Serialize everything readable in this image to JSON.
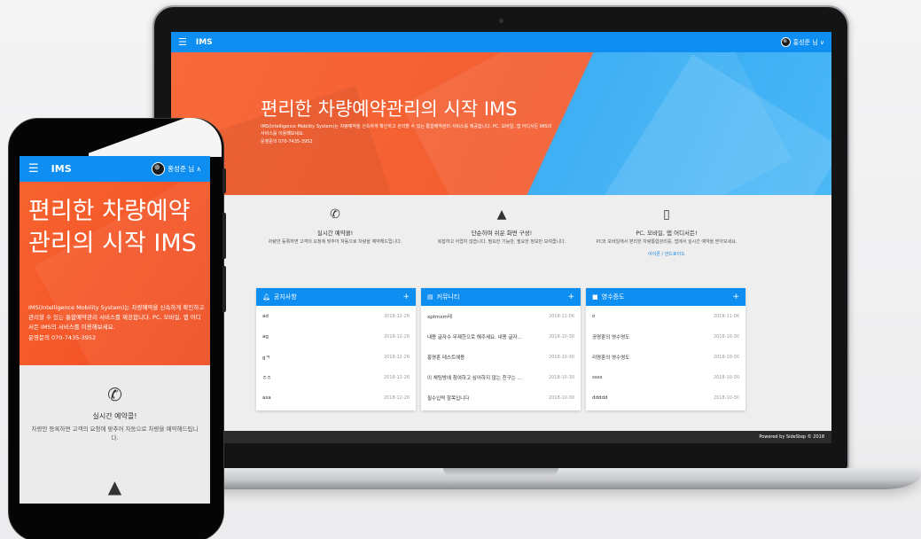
{
  "laptop": {
    "appbar": {
      "menu_icon": "menu-icon",
      "title": "IMS",
      "user": "홍성준 님 ∨"
    },
    "hero": {
      "title": "편리한 차량예약관리의 시작 IMS",
      "desc": "IMS(Intelligence Mobility System)는 차량예약을 신속하게 확인하고 관리할 수 있는 통합예약관리 서비스를 제공합니다. PC, 모바일, 앱 어디서든 IMS의 서비스를 이용해보세요.",
      "phone": "운영문의 070-7435-3952"
    },
    "features": [
      {
        "icon": "phone-call-icon",
        "title": "실시간 예약콜!",
        "desc": "차량만 등록하면 고객의 요청에 맞추어 자동으로 차량을 예약해드립니다.",
        "link": ""
      },
      {
        "icon": "shapes-icon",
        "title": "단순하며 쉬운 화면 구성!",
        "desc": "복잡하고 어렵지 않습니다. 필요한 기능만, 필요한 정보만 보여줍니다.",
        "link": ""
      },
      {
        "icon": "mobile-device-icon",
        "title": "PC, 모바일, 앱 어디서든!",
        "desc": "PC와 모바일에서 편리한 차량통합관리를, 앱에서 실시간 예약을 받아보세요.",
        "link": "아이폰 / 안드로이드"
      }
    ],
    "cards": [
      {
        "icon": "bell-icon",
        "title": "공지사항",
        "plus": "+",
        "rows": [
          {
            "text": "ad",
            "date": "2018-12-26"
          },
          {
            "text": "ag",
            "date": "2018-12-26"
          },
          {
            "text": "gㅋ",
            "date": "2018-12-26"
          },
          {
            "text": "ㅎㅎ",
            "date": "2018-12-26"
          },
          {
            "text": "asa",
            "date": "2018-12-26"
          }
        ]
      },
      {
        "icon": "chat-icon",
        "title": "커뮤니티",
        "plus": "+",
        "rows": [
          {
            "text": "xptmxm테",
            "date": "2018-11-06"
          },
          {
            "text": "내용 글자수 무제한으로 해주세요. 내용 글자...",
            "date": "2018-10-30"
          },
          {
            "text": "홍명훈 테스트예용",
            "date": "2018-10-30"
          },
          {
            "text": "이 채팅방에 참여하고 싶어하지 않는 친구는 ...",
            "date": "2018-10-30"
          },
          {
            "text": "필수입력 항목입니다",
            "date": "2018-10-30"
          }
        ]
      },
      {
        "icon": "briefcase-icon",
        "title": "영수증도",
        "plus": "+",
        "rows": [
          {
            "text": "o",
            "date": "2018-11-06"
          },
          {
            "text": "공명훈의 영수영도",
            "date": "2018-10-30"
          },
          {
            "text": "리명훈의 영수영도",
            "date": "2018-10-30"
          },
          {
            "text": "ssss",
            "date": "2018-10-30"
          },
          {
            "text": "ddddd",
            "date": "2018-10-30"
          }
        ]
      }
    ],
    "footer": "Powered by SideStep © 2018"
  },
  "phone": {
    "appbar": {
      "menu_icon": "menu-icon",
      "title": "IMS",
      "user": "홍성준 님 ∧"
    },
    "hero": {
      "title": "편리한 차량예약관리의 시작 IMS",
      "desc": "IMS(Intelligence Mobility System)는 차량예약을 신속하게 확인하고 관리할 수 있는 통합예약관리 서비스를 제공합니다. PC, 모바일, 앱 어디서든 IMS의 서비스를 이용해보세요.",
      "phone": "운영문의 070-7435-3952"
    },
    "features": [
      {
        "icon": "phone-call-icon",
        "title": "실시간 예약콜!",
        "desc": "차량만 등록하면 고객의 요청에 맞추어 자동으로 차량을 예약해드립니다."
      },
      {
        "icon": "shapes-icon",
        "title": "",
        "desc": ""
      }
    ]
  },
  "colors": {
    "primary": "#0e8ef0",
    "hero_orange": "#f45f31",
    "hero_blue": "#2fa9f3",
    "footer": "#2b2b2b"
  }
}
